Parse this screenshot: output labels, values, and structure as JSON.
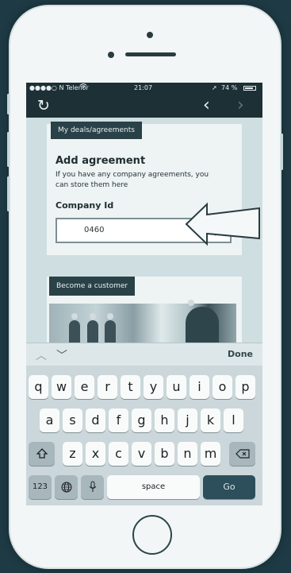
{
  "status": {
    "carrier": "●●●●○ N Telenor",
    "time": "21:07",
    "battery": "74 %"
  },
  "nav": {
    "refresh_icon": "refresh-icon",
    "back_icon": "chevron-left-icon",
    "forward_icon": "chevron-right-icon"
  },
  "deals": {
    "tab": "My deals/agreements",
    "heading": "Add agreement",
    "desc_line1": "If you have any company agreements, you",
    "desc_line2": "can store them here",
    "field_label": "Company Id",
    "field_value": "0460"
  },
  "customer": {
    "tab": "Become a customer"
  },
  "accessory": {
    "done": "Done"
  },
  "keyboard": {
    "row1": [
      "q",
      "w",
      "e",
      "r",
      "t",
      "y",
      "u",
      "i",
      "o",
      "p"
    ],
    "row2": [
      "a",
      "s",
      "d",
      "f",
      "g",
      "h",
      "j",
      "k",
      "l"
    ],
    "row3": [
      "z",
      "x",
      "c",
      "v",
      "b",
      "n",
      "m"
    ],
    "numbers": "123",
    "space": "space",
    "go": "Go"
  },
  "colors": {
    "background": "#1e3a44",
    "header": "#1d3036",
    "accent": "#294147"
  }
}
